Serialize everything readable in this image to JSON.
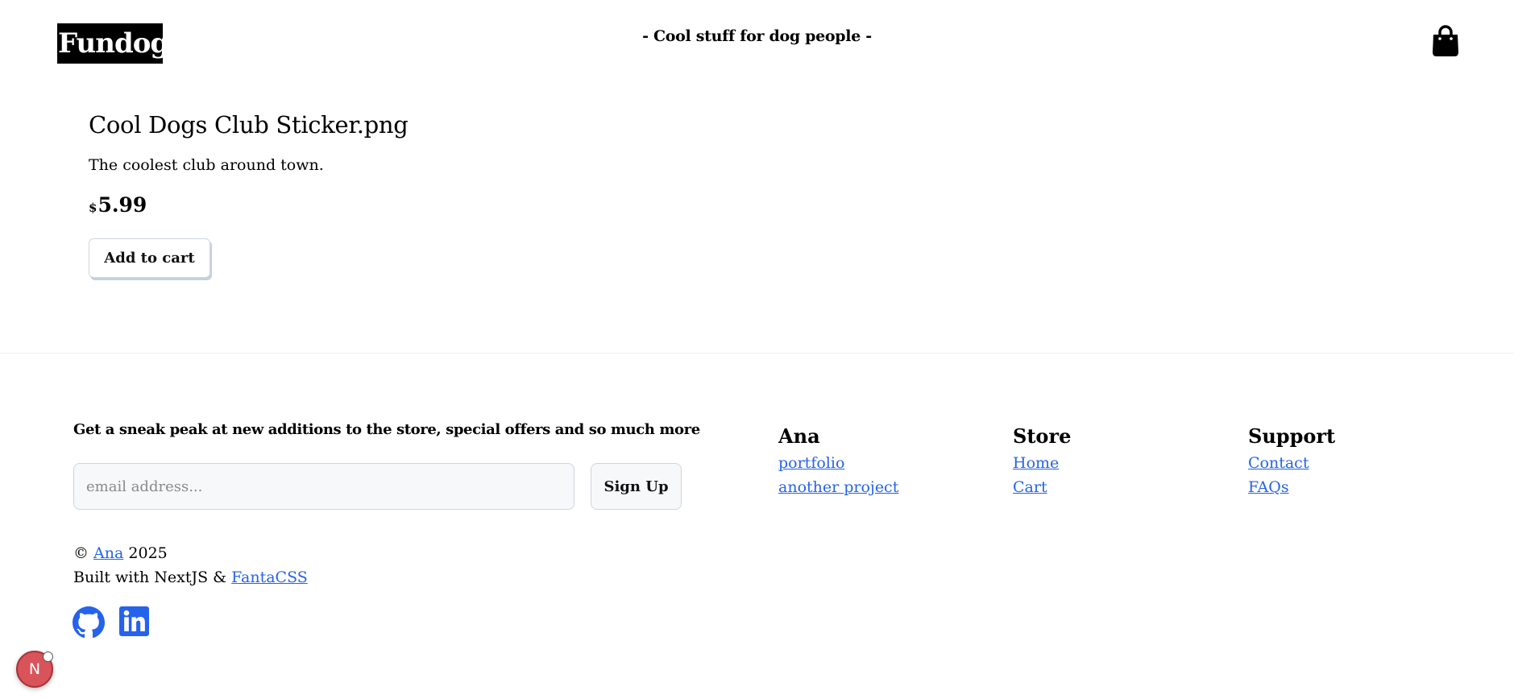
{
  "header": {
    "logo": "Fundog",
    "tagline": "- Cool stuff for dog people -",
    "cart_icon": "shopping-bag-icon"
  },
  "product": {
    "title": "Cool Dogs Club Sticker.png",
    "description": "The coolest club around town.",
    "currency": "$",
    "price": "5.99",
    "add_to_cart_label": "Add to cart"
  },
  "newsletter": {
    "heading": "Get a sneak peak at new additions to the store, special offers and so much more",
    "email_placeholder": "email address...",
    "signup_label": "Sign Up"
  },
  "footer": {
    "columns": [
      {
        "title": "Ana",
        "links": [
          "portfolio",
          "another project"
        ]
      },
      {
        "title": "Store",
        "links": [
          "Home",
          "Cart"
        ]
      },
      {
        "title": "Support",
        "links": [
          "Contact",
          "FAQs"
        ]
      }
    ],
    "copyright_prefix": "©",
    "copyright_author": "Ana",
    "copyright_year": "2025",
    "built_with_prefix": "Built with NextJS &",
    "built_with_link": "FantaCSS",
    "social_icons": [
      "github-icon",
      "linkedin-icon"
    ]
  },
  "dev_badge": {
    "label": "N"
  },
  "colors": {
    "link": "#2563eb",
    "logo_bg": "#000000",
    "badge": "#d9545a"
  }
}
